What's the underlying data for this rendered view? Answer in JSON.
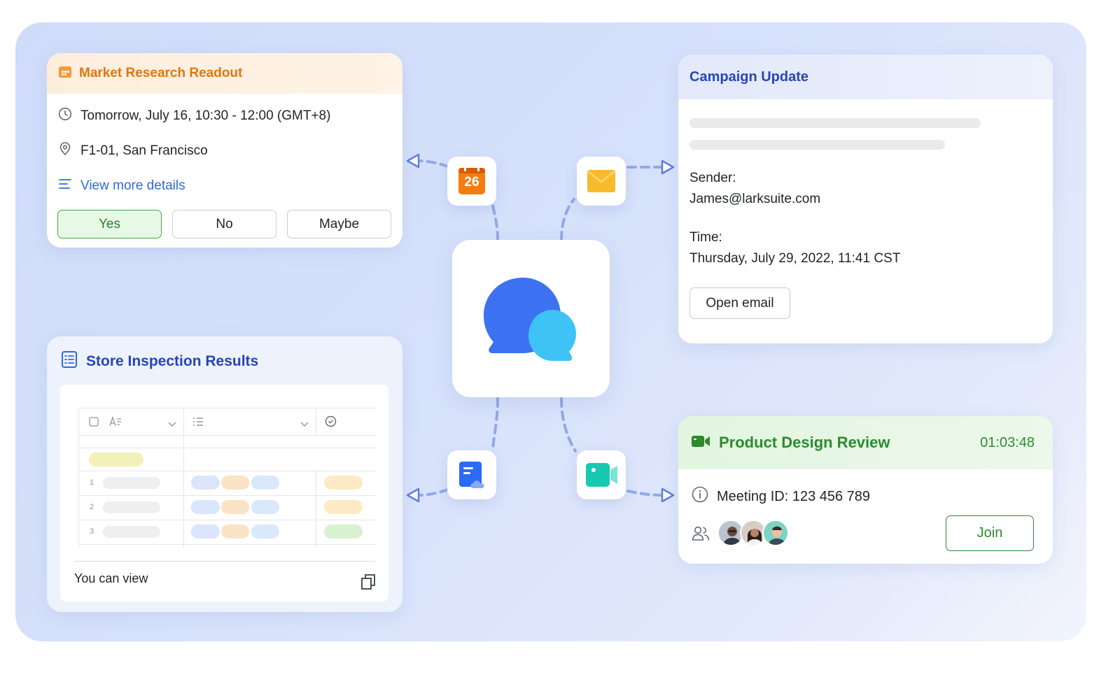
{
  "market_card": {
    "title": "Market Research Readout",
    "time": "Tomorrow, July 16, 10:30 - 12:00 (GMT+8)",
    "location": "F1-01, San Francisco",
    "details_link": "View more details",
    "rsvp": {
      "yes": "Yes",
      "no": "No",
      "maybe": "Maybe",
      "selected": "Yes"
    }
  },
  "campaign_card": {
    "title": "Campaign Update",
    "sender_label": "Sender:",
    "sender_value": "James@larksuite.com",
    "time_label": "Time:",
    "time_value": "Thursday, July 29, 2022, 11:41 CST",
    "open_button": "Open email"
  },
  "store_card": {
    "title": "Store Inspection Results",
    "row_numbers": [
      "1",
      "2",
      "3"
    ],
    "permission": "You can view"
  },
  "product_card": {
    "title": "Product Design Review",
    "elapsed": "01:03:48",
    "meeting_id": "Meeting ID: 123 456 789",
    "join_button": "Join"
  },
  "nodes": {
    "calendar_day": "26"
  },
  "icons": [
    "calendar-icon",
    "clock-icon",
    "location-pin-icon",
    "list-icon",
    "document-icon",
    "video-camera-icon",
    "info-icon",
    "people-icon",
    "copy-icon",
    "chat-bubbles-icon",
    "mail-icon",
    "docs-cloud-icon",
    "video-call-icon"
  ],
  "colors": {
    "market_accent": "#e0770d",
    "campaign_accent": "#2646b5",
    "product_accent": "#2d8a2f",
    "link": "#2d6ae0",
    "connector": "#8fa5e6"
  }
}
